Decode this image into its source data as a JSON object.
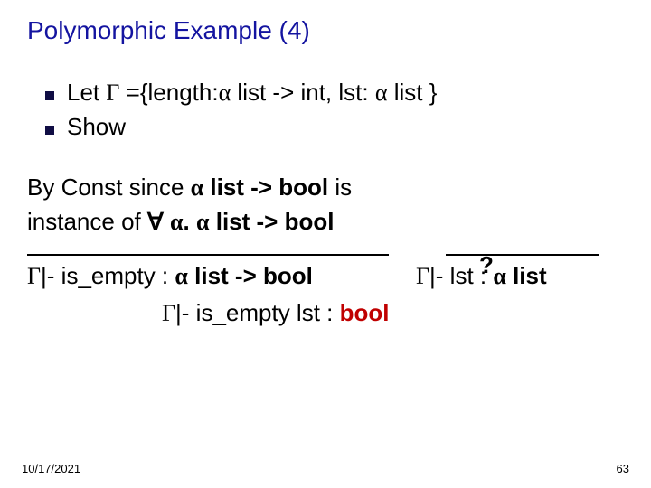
{
  "slide": {
    "title": "Polymorphic Example (4)",
    "bullets": {
      "let_prefix": "Let  ",
      "gamma": "Γ",
      "let_body": " ={length:",
      "alpha": "α",
      "list_to_int": " list -> int,  lst: ",
      "list_close": " list }",
      "show": "Show"
    },
    "body": {
      "byconst1_a": "By Const since ",
      "byconst1_b": " list -> bool",
      "byconst1_c": " is",
      "instance_a": "instance of",
      "forall": "∀",
      "dot": ". ",
      "instance_b": " list -> bool",
      "qmark": "?"
    },
    "rules": {
      "turnstile": "|- ",
      "isempty": "is_empty : ",
      "list_to_bool": " list -> bool",
      "lst": "lst : ",
      "list": " list",
      "conclusion": "is_empty lst : ",
      "bool": "bool"
    },
    "footer": {
      "date": "10/17/2021",
      "page": "63"
    }
  }
}
